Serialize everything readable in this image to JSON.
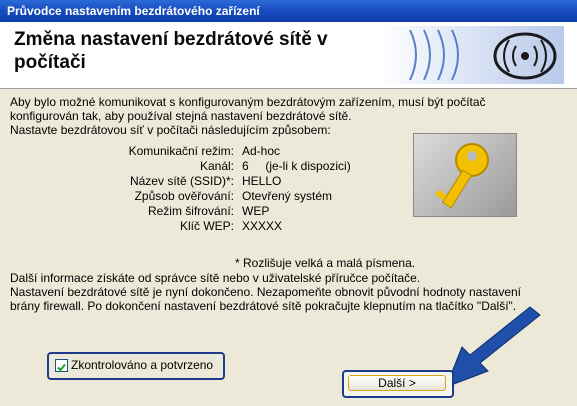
{
  "window": {
    "title": "Průvodce nastavením bezdrátového zařízení"
  },
  "header": {
    "title": "Změna nastavení bezdrátové sítě v počítači"
  },
  "intro": {
    "line1": "Aby bylo možné komunikovat s konfigurovaným bezdrátovým zařízením, musí být počítač",
    "line2": "konfigurován tak, aby používal stejná nastavení bezdrátové sítě.",
    "line3": "Nastavte bezdrátovou síť v počítači následujícím způsobem:"
  },
  "settings": [
    {
      "label": "Komunikační režim:",
      "value": "Ad-hoc"
    },
    {
      "label": "Kanál:",
      "value": "6     (je-li k dispozici)"
    },
    {
      "label": "Název sítě (SSID)*:",
      "value": "HELLO"
    },
    {
      "label": "Způsob ověřování:",
      "value": "Otevřený systém"
    },
    {
      "label": "Režim šifrování:",
      "value": "WEP"
    },
    {
      "label": "Klíč WEP:",
      "value": "XXXXX"
    }
  ],
  "case_note": "* Rozlišuje velká a malá písmena.",
  "after": {
    "line1": "Další informace získáte od správce sítě nebo v uživatelské příručce počítače.",
    "line2": "Nastavení bezdrátové sítě je nyní dokončeno. Nezapomeňte obnovit původní hodnoty nastavení",
    "line3": "brány firewall. Po dokončení nastavení bezdrátové sítě pokračujte klepnutím na tlačítko \"Další\"."
  },
  "checkbox": {
    "label": "Zkontrolováno a potvrzeno",
    "checked": true
  },
  "buttons": {
    "next": "Další >"
  },
  "icons": {
    "header": "wireless-signal-icon",
    "key": "key-icon",
    "arrow": "arrow-icon"
  }
}
